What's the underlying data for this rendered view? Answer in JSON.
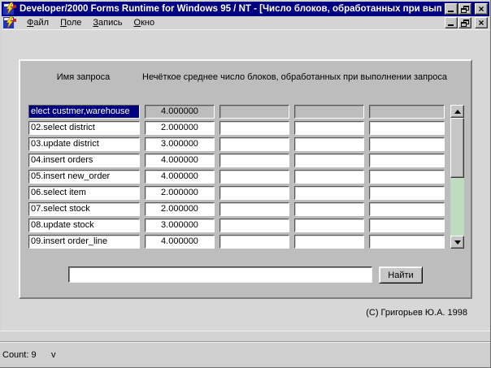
{
  "window": {
    "title": "Developer/2000 Forms Runtime for Windows 95 / NT - [Число  блоков, обработанных при вып..."
  },
  "menu": {
    "items": [
      {
        "id": "file",
        "first": "Ф",
        "rest": "айл"
      },
      {
        "id": "field",
        "first": "П",
        "rest": "оле"
      },
      {
        "id": "record",
        "first": "З",
        "rest": "апись"
      },
      {
        "id": "window",
        "first": "О",
        "rest": "кно"
      }
    ]
  },
  "icons": {
    "close": "×"
  },
  "form": {
    "name_header": "Имя запроса",
    "value_header": "Нечёткое среднее число блоков, обработанных при выполнении запроса",
    "rows": [
      {
        "name": "elect custmer,warehouse",
        "value": "4.000000",
        "selected": true
      },
      {
        "name": "02.select  district",
        "value": "2.000000"
      },
      {
        "name": "03.update district",
        "value": "3.000000"
      },
      {
        "name": "04.insert orders",
        "value": "4.000000"
      },
      {
        "name": "05.insert new_order",
        "value": "4.000000"
      },
      {
        "name": "06.select  item",
        "value": "2.000000"
      },
      {
        "name": "07.select stock",
        "value": "2.000000"
      },
      {
        "name": "08.update stock",
        "value": "3.000000"
      },
      {
        "name": "09.insert order_line",
        "value": "4.000000"
      }
    ],
    "search": {
      "value": "",
      "button_label": "Найти"
    },
    "copyright": "(С) Григорьев Ю.А. 1998"
  },
  "status_bar": {
    "count": "Count: 9",
    "lamp": "v"
  },
  "colors": {
    "titlebar": "#000080",
    "selection_bg": "#000080",
    "selection_fg": "#ffffff",
    "canvas": "#bdbdbd",
    "workspace": "#d7d7d7",
    "scrollbar_track": "#c0dcc0"
  }
}
